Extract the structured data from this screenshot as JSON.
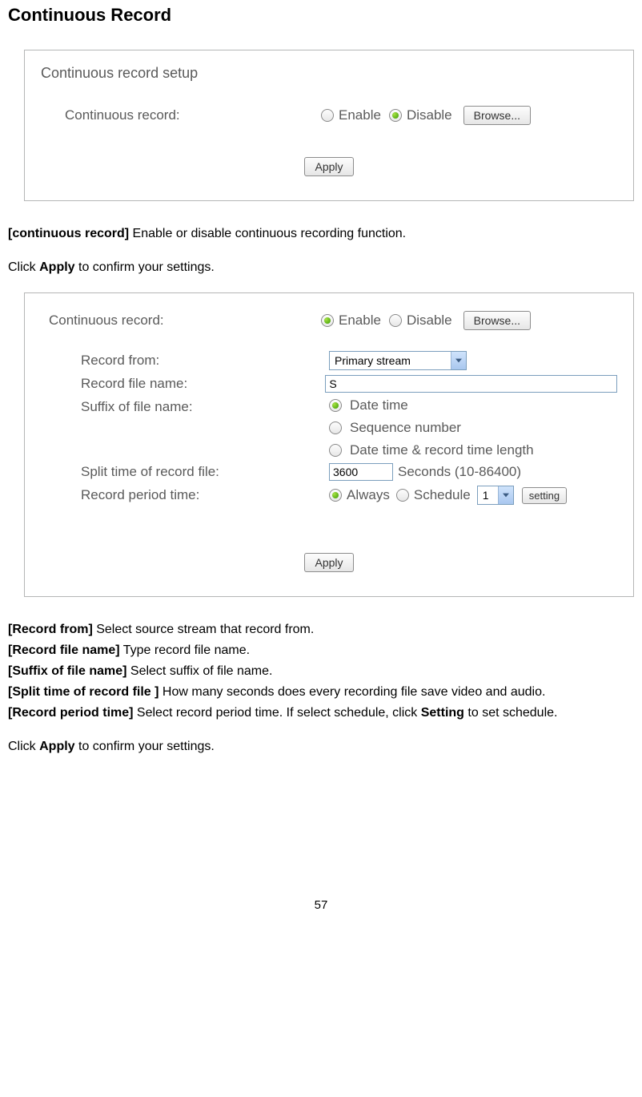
{
  "page": {
    "title": "Continuous Record",
    "number": "57"
  },
  "panel1": {
    "title": "Continuous record setup",
    "label": "Continuous record:",
    "enable": "Enable",
    "disable": "Disable",
    "browse": "Browse...",
    "apply": "Apply"
  },
  "desc1": {
    "key": "[continuous record]",
    "text": " Enable or disable continuous recording function."
  },
  "apply_sentence": {
    "pre": "Click ",
    "bold": "Apply",
    "post": " to confirm your settings."
  },
  "panel2": {
    "cr_label": "Continuous record:",
    "enable": "Enable",
    "disable": "Disable",
    "browse": "Browse...",
    "record_from_label": "Record from:",
    "record_from_value": "Primary stream",
    "file_name_label": "Record file name:",
    "file_name_value": "S",
    "suffix_label": "Suffix of file name:",
    "suffix_opts": {
      "date_time": "Date time",
      "seq": "Sequence number",
      "both": "Date time & record time length"
    },
    "split_label": "Split time of record file:",
    "split_value": "3600",
    "split_hint": "Seconds (10-86400)",
    "period_label": "Record period time:",
    "period_always": "Always",
    "period_schedule": "Schedule",
    "schedule_num": "1",
    "setting": "setting",
    "apply": "Apply"
  },
  "descs": {
    "record_from": {
      "key": "[Record from]",
      "text": " Select source stream that record from."
    },
    "file_name": {
      "key": "[Record file name]",
      "text": " Type record file name."
    },
    "suffix": {
      "key": "[Suffix of file name]",
      "text": " Select suffix of file name."
    },
    "split": {
      "key": "[Split time of record file ]",
      "text": " How many seconds does every recording file save video and audio."
    },
    "period": {
      "key": "[Record period time]",
      "text": " Select record period time. If select schedule, click ",
      "bold": "Setting",
      "post": " to set schedule."
    }
  }
}
